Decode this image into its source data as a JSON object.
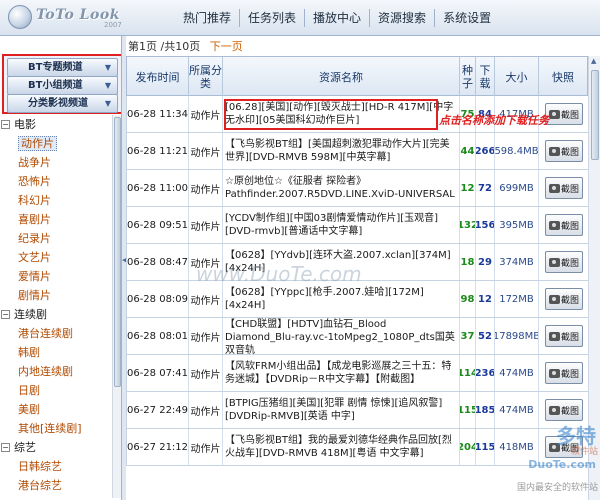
{
  "app": {
    "logo_text": "ToTo Look",
    "logo_year": "2007"
  },
  "nav": [
    "热门推荐",
    "任务列表",
    "播放中心",
    "资源搜索",
    "系统设置"
  ],
  "sidebar": {
    "channels": [
      "BT专题频道",
      "BT小组频道",
      "分类影视频道"
    ],
    "tree": [
      {
        "label": "电影",
        "items": [
          "动作片",
          "战争片",
          "恐怖片",
          "科幻片",
          "喜剧片",
          "纪录片",
          "文艺片",
          "爱情片",
          "剧情片"
        ]
      },
      {
        "label": "连续剧",
        "items": [
          "港台连续剧",
          "韩剧",
          "内地连续剧",
          "日剧",
          "美剧",
          "其他[连续剧]"
        ]
      },
      {
        "label": "综艺",
        "items": [
          "日韩综艺",
          "港台综艺"
        ]
      }
    ],
    "selected": "动作片"
  },
  "pager": {
    "text": "第1页 /共10页",
    "next": "下一页"
  },
  "table": {
    "headers": {
      "time": "发布时间",
      "category": "所属分类",
      "name": "资源名称",
      "seeds": "种子",
      "downloads": "下载",
      "size": "大小",
      "preview": "快照"
    },
    "shot_label": "截图",
    "rows": [
      {
        "time": "06-28 11:34",
        "category": "动作片",
        "name": "[06.28][美国][动作][毁灭战士][HD-R 417M][中字无水印][05美国科幻动作巨片]",
        "seeds": "75",
        "downloads": "84",
        "size": "417MB"
      },
      {
        "time": "06-28 11:21",
        "category": "动作片",
        "name": "【飞鸟影视BT组】[美国超刺激犯罪动作大片][完美世界][DVD-RMVB 598M][中英字幕]",
        "seeds": "44",
        "downloads": "266",
        "size": "598.4MB"
      },
      {
        "time": "06-28 11:00",
        "category": "动作片",
        "name": "☆原创地位☆《征服者 探险者》Pathfinder.2007.R5DVD.LINE.XviD-UNIVERSAL",
        "seeds": "12",
        "downloads": "72",
        "size": "699MB"
      },
      {
        "time": "06-28 09:51",
        "category": "动作片",
        "name": "[YCDV制作组][中国03剧情爱情动作片][玉观音][DVD-rmvb][普通话中文字幕]",
        "seeds": "132",
        "downloads": "156",
        "size": "395MB"
      },
      {
        "time": "06-28 08:47",
        "category": "动作片",
        "name": "【0628】[YYdvb][连环大盗.2007.xclan][374M][4x24H]",
        "seeds": "18",
        "downloads": "29",
        "size": "374MB"
      },
      {
        "time": "06-28 08:09",
        "category": "动作片",
        "name": "【0628】[YYppc][枪手.2007.娃哈][172M][4x24H]",
        "seeds": "98",
        "downloads": "12",
        "size": "172MB"
      },
      {
        "time": "06-28 08:01",
        "category": "动作片",
        "name": "【CHD联盟】[HDTV]血钻石_Blood Diamond_Blu-ray.vc-1toMpeg2_1080P_dts国英双音轨",
        "seeds": "37",
        "downloads": "52",
        "size": "17898MB"
      },
      {
        "time": "06-28 07:41",
        "category": "动作片",
        "name": "【风软FRM小组出品】【成龙电影巡展之三十五：特务迷城】【DVDRip－R中文字幕】【附截图】",
        "seeds": "114",
        "downloads": "236",
        "size": "474MB"
      },
      {
        "time": "06-27 22:49",
        "category": "动作片",
        "name": "[BTPIG压猪组][美国][犯罪 剧情 惊悚][追风叙警][DVDRip-RMVB][英语 中字]",
        "seeds": "115",
        "downloads": "185",
        "size": "474MB"
      },
      {
        "time": "06-27 21:12",
        "category": "动作片",
        "name": "【飞鸟影视BT组】我的最爱刘德华经典作品回放[烈火战车][DVD-RMVB 418M][粤语 中文字幕]",
        "seeds": "204",
        "downloads": "115",
        "size": "418MB"
      }
    ]
  },
  "annotation": "点击名称添加下载任务",
  "watermark": "www.DuoTe.com",
  "brand": {
    "line1": "多特",
    "line2": "软件站",
    "line3": "DuoTe.com",
    "line4": "国内最安全的软件站"
  }
}
